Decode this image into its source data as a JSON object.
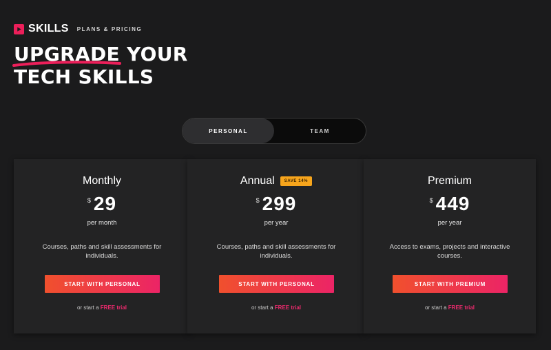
{
  "brand": {
    "name": "SKILLS",
    "subtitle": "PLANS & PRICING",
    "accent": "#ec1f5a"
  },
  "hero": {
    "highlight": "UPGRADE",
    "line1_rest": "YOUR",
    "line2": "TECH SKILLS"
  },
  "toggle": {
    "options": [
      "PERSONAL",
      "TEAM"
    ],
    "selected": "PERSONAL"
  },
  "plans": [
    {
      "title": "Monthly",
      "currency": "$",
      "price": "29",
      "period": "per month",
      "description": "Courses, paths and skill assessments for individuals.",
      "cta": "START WITH PERSONAL",
      "trial_prefix": "or start a",
      "trial_link": "FREE trial"
    },
    {
      "title": "Annual",
      "badge": "SAVE 14%",
      "currency": "$",
      "price": "299",
      "period": "per year",
      "description": "Courses, paths and skill assessments for individuals.",
      "cta": "START WITH PERSONAL",
      "trial_prefix": "or start a",
      "trial_link": "FREE trial"
    },
    {
      "title": "Premium",
      "currency": "$",
      "price": "449",
      "period": "per year",
      "description": "Access to exams, projects and interactive courses.",
      "cta": "START WITH PREMIUM",
      "trial_prefix": "or start a",
      "trial_link": "FREE trial"
    }
  ],
  "colors": {
    "background": "#1b1b1c",
    "card": "#232324",
    "cta_gradient_start": "#f0502d",
    "cta_gradient_end": "#ec2466",
    "badge": "#f7a51c",
    "free_link": "#ee2a6e"
  },
  "icons": {
    "logo": "play-icon"
  }
}
